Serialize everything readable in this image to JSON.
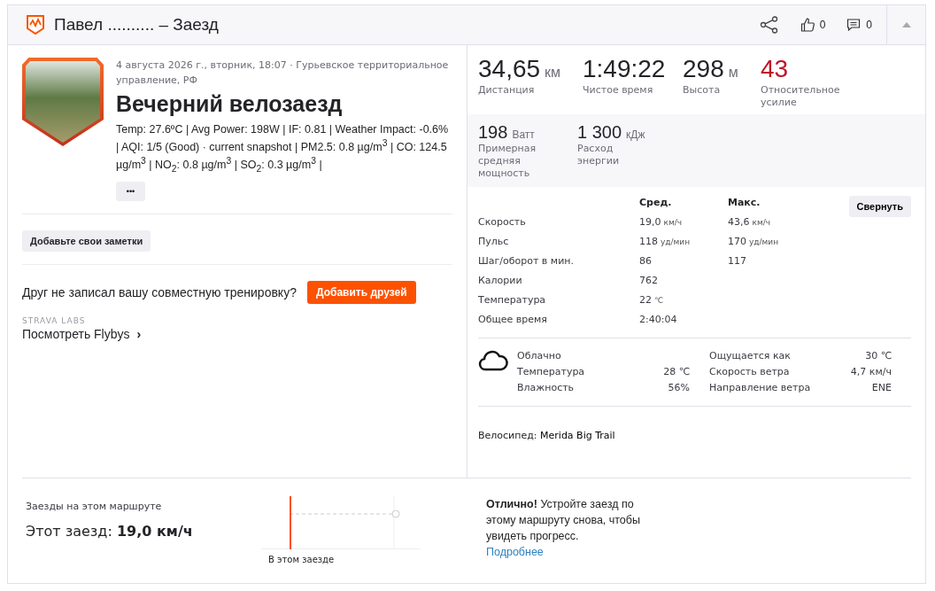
{
  "header": {
    "title": "Павел .......... – Заезд",
    "likes": "0",
    "comments": "0"
  },
  "activity": {
    "meta": "4 августа 2026 г., вторник, 18:07 · Гурьевское территориальное управление, РФ",
    "name": "Вечерний велозаезд",
    "description": "Temp: 27.6ºC | Avg Power: 198W | IF: 0.81 | Weather Impact: -0.6% | AQI: 1/5 (Good) · current snapshot | PM2.5: 0.8 µg/m$^{3}$ | CO: 124.5 µg/m$^{3}$ | NO$_{2}$: 0.8 µg/m$^{3}$ | SO$_{2}$: 0.3 µg/m$^{3}$ |",
    "more": "•••"
  },
  "notes_button": "Добавьте свои заметки",
  "friends": {
    "text": "Друг не записал вашу совместную тренировку?",
    "button": "Добавить друзей"
  },
  "labs": {
    "label": "STRAVA LABS",
    "link": "Посмотреть Flybys",
    "chevron": "›"
  },
  "primary_stats": [
    {
      "value": "34,65",
      "unit": "км",
      "label": "Дистанция",
      "kind": "normal"
    },
    {
      "value": "1:49:22",
      "label": "Чистое время",
      "kind": "normal"
    },
    {
      "value": "298",
      "unit": "м",
      "label": "Высота",
      "kind": "normal"
    },
    {
      "value": "43",
      "label": "Относительное усилие",
      "kind": "effort"
    }
  ],
  "secondary_stats": [
    {
      "value": "198",
      "unit": "Ватт",
      "label": "Примерная средняя мощность"
    },
    {
      "value": "1 300",
      "unit": "кДж",
      "label": "Расход энергии"
    }
  ],
  "details": {
    "columns": [
      "Сред.",
      "Макс."
    ],
    "collapse": "Свернуть",
    "rows": [
      {
        "label": "Скорость",
        "avg": "19,0",
        "avg_unit": "км/ч",
        "max": "43,6",
        "max_unit": "км/ч"
      },
      {
        "label": "Пульс",
        "avg": "118",
        "avg_unit": "уд/мин",
        "max": "170",
        "max_unit": "уд/мин"
      },
      {
        "label": "Шаг/оборот в мин.",
        "avg": "86",
        "max": "117"
      },
      {
        "label": "Калории",
        "avg": "762"
      },
      {
        "label": "Температура",
        "avg": "22",
        "avg_unit": "℃"
      },
      {
        "label": "Общее время",
        "avg": "2:40:04"
      }
    ]
  },
  "weather": [
    {
      "label": "Облачно"
    },
    {
      "label": "Ощущается как",
      "value": "30 ℃"
    },
    {
      "label": "Температура",
      "value": "28 ℃"
    },
    {
      "label": "Скорость ветра",
      "value": "4,7 км/ч"
    },
    {
      "label": "Влажность",
      "value": "56%"
    },
    {
      "label": "Направление ветра",
      "value": "ENE"
    }
  ],
  "bike": {
    "label": "Велосипед:",
    "name": "Merida Big Trail"
  },
  "route": {
    "title": "Заезды на этом маршруте",
    "this_label": "Этот заезд:",
    "this_value": "19,0 км/ч",
    "chart_label": "В этом заезде",
    "message": "**Отлично!** Устройте заезд по этому маршруту снова, чтобы увидеть прогресс.",
    "link": "Подробнее"
  }
}
